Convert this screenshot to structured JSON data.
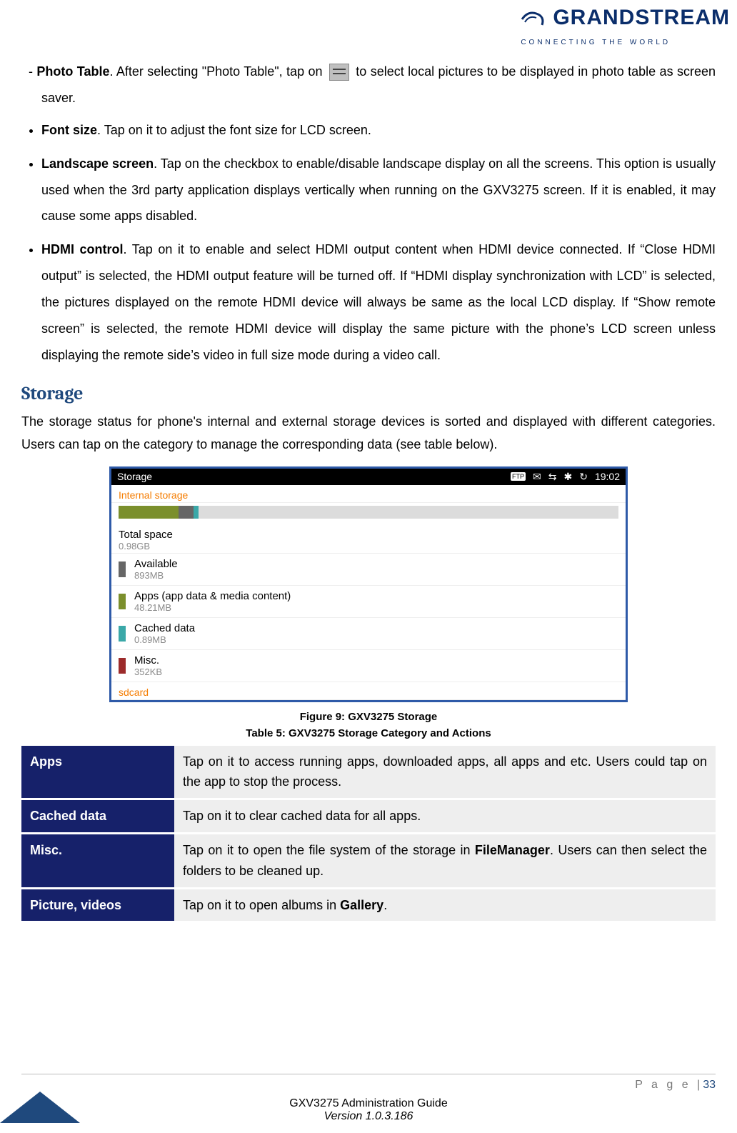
{
  "brand": {
    "name": "GRANDSTREAM",
    "tagline": "CONNECTING THE WORLD"
  },
  "bullets": {
    "photo_table": {
      "title": "Photo Table",
      "pre": ". After selecting \"Photo Table\", tap on ",
      "post": " to select local pictures to be displayed in photo table as screen saver."
    },
    "font_size": {
      "title": "Font size",
      "text": ". Tap on it to adjust the font size for LCD screen."
    },
    "landscape": {
      "title": "Landscape screen",
      "text": ". Tap on the checkbox to enable/disable landscape display on all the screens. This option is usually used when the 3rd party application displays vertically when running on the GXV3275 screen. If it is enabled, it may cause some apps disabled."
    },
    "hdmi": {
      "title": "HDMI control",
      "text": ". Tap on it to enable and select HDMI output content when HDMI device connected. If “Close HDMI output” is selected, the HDMI output feature will be turned off. If “HDMI display synchronization with LCD” is selected, the pictures displayed on the remote HDMI device will always be same as the local LCD display. If “Show remote screen” is selected, the remote HDMI device will display the same picture with the phone’s LCD screen unless displaying the remote side’s video in full size mode during a video call."
    }
  },
  "storage": {
    "heading": "Storage",
    "intro": "The storage status for phone's internal and external storage devices is sorted and displayed with different categories. Users can tap on the category to manage the corresponding data (see table below)."
  },
  "screenshot": {
    "title": "Storage",
    "status": {
      "ftp": "FTP",
      "time": "19:02"
    },
    "section1": "Internal storage",
    "total": {
      "label": "Total space",
      "value": "0.98GB"
    },
    "rows": [
      {
        "swatch": "sw-dgrey",
        "label": "Available",
        "value": "893MB"
      },
      {
        "swatch": "sw-green",
        "label": "Apps (app data & media content)",
        "value": "48.21MB"
      },
      {
        "swatch": "sw-teal",
        "label": "Cached data",
        "value": "0.89MB"
      },
      {
        "swatch": "sw-red",
        "label": "Misc.",
        "value": "352KB"
      }
    ],
    "section2": "sdcard"
  },
  "figure_caption": "Figure 9: GXV3275 Storage",
  "table_caption": "Table 5: GXV3275 Storage Category and Actions",
  "cat_table": [
    {
      "h": "Apps",
      "d_pre": "Tap on it to access running apps, downloaded apps, all apps and etc. Users could tap on the app to stop the process.",
      "bold": "",
      "d_post": ""
    },
    {
      "h": "Cached data",
      "d_pre": "Tap on it to clear cached data for all apps.",
      "bold": "",
      "d_post": ""
    },
    {
      "h": "Misc.",
      "d_pre": "Tap on it to open the file system of the storage in ",
      "bold": "FileManager",
      "d_post": ". Users can then select the folders to be cleaned up."
    },
    {
      "h": "Picture, videos",
      "d_pre": "Tap on it to open albums in ",
      "bold": "Gallery",
      "d_post": "."
    }
  ],
  "footer": {
    "page_label": "P a g e  |",
    "page_no": "33",
    "line1": "GXV3275 Administration Guide",
    "line2": "Version 1.0.3.186"
  }
}
